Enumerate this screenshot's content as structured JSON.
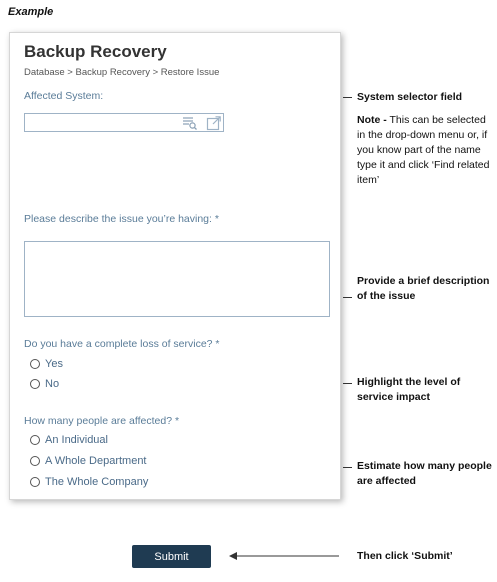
{
  "heading": "Example",
  "form": {
    "title": "Backup Recovery",
    "breadcrumb": "Database > Backup Recovery > Restore Issue",
    "affected_system_label": "Affected System:",
    "affected_system_value": "",
    "issue_label": "Please describe the issue you’re having: *",
    "issue_value": "",
    "loss_label": "Do you have a complete loss of service? *",
    "loss_options": [
      "Yes",
      "No"
    ],
    "people_label": "How many people are affected? *",
    "people_options": [
      "An Individual",
      "A Whole Department",
      "The Whole Company"
    ],
    "submit_label": "Submit"
  },
  "annotations": {
    "system_selector": "System selector field",
    "note_label": "Note -",
    "note_text": " This can be selected in the drop-down menu or, if you know part of the name type it and click ‘Find related item’",
    "describe": "Provide a brief description of the issue",
    "impact": "Highlight the level of service impact",
    "estimate": "Estimate how many people are affected",
    "submit": "Then click ‘Submit’"
  },
  "colors": {
    "label": "#5a7c98",
    "submit_bg": "#1f3b52",
    "border": "#9fb3c6"
  },
  "icons": [
    "search-list-icon",
    "open-link-icon",
    "arrow-left-icon"
  ]
}
